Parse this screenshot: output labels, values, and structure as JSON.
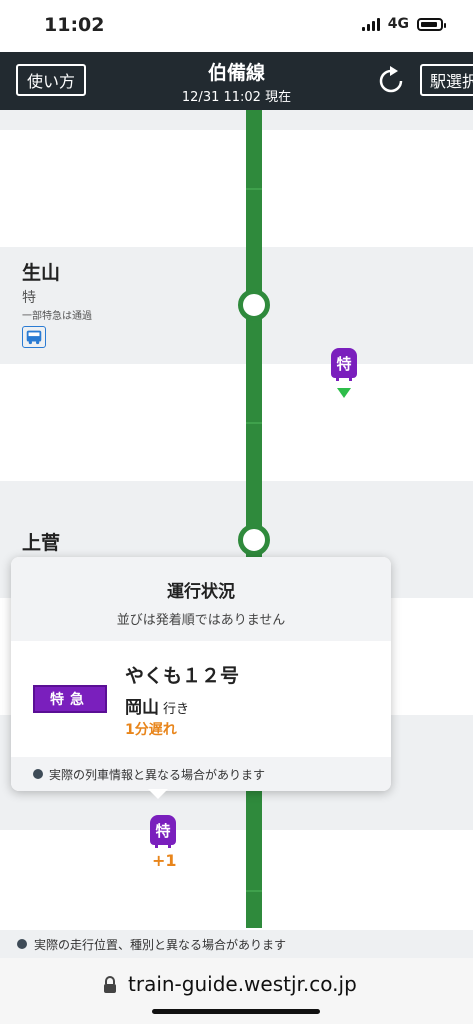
{
  "status_bar": {
    "time": "11:02",
    "network": "4G"
  },
  "header": {
    "usage_label": "使い方",
    "title": "伯備線",
    "timestamp": "12/31 11:02 現在",
    "station_select_label": "駅選択"
  },
  "stations": [
    {
      "name": "生山",
      "type": "特",
      "note": "一部特急は通過",
      "icon": "bus-icon"
    },
    {
      "name": "上菅"
    }
  ],
  "trains": [
    {
      "badge": "特"
    },
    {
      "badge": "特",
      "count": "+1"
    }
  ],
  "popup": {
    "title": "運行状況",
    "subtitle": "並びは発着順ではありません",
    "type_label": "特急",
    "train_name": "やくも１２号",
    "destination": "岡山",
    "destination_suffix": "行き",
    "delay": "1分遅れ",
    "footer": "実際の列車情報と異なる場合があります"
  },
  "bottom_note": "実際の走行位置、種別と異なる場合があります",
  "browser": {
    "url": "train-guide.westjr.co.jp"
  },
  "colors": {
    "header_bg": "#222a30",
    "track": "#2f8a3c",
    "limited_express": "#7a1fbd",
    "delay": "#e8851b"
  }
}
